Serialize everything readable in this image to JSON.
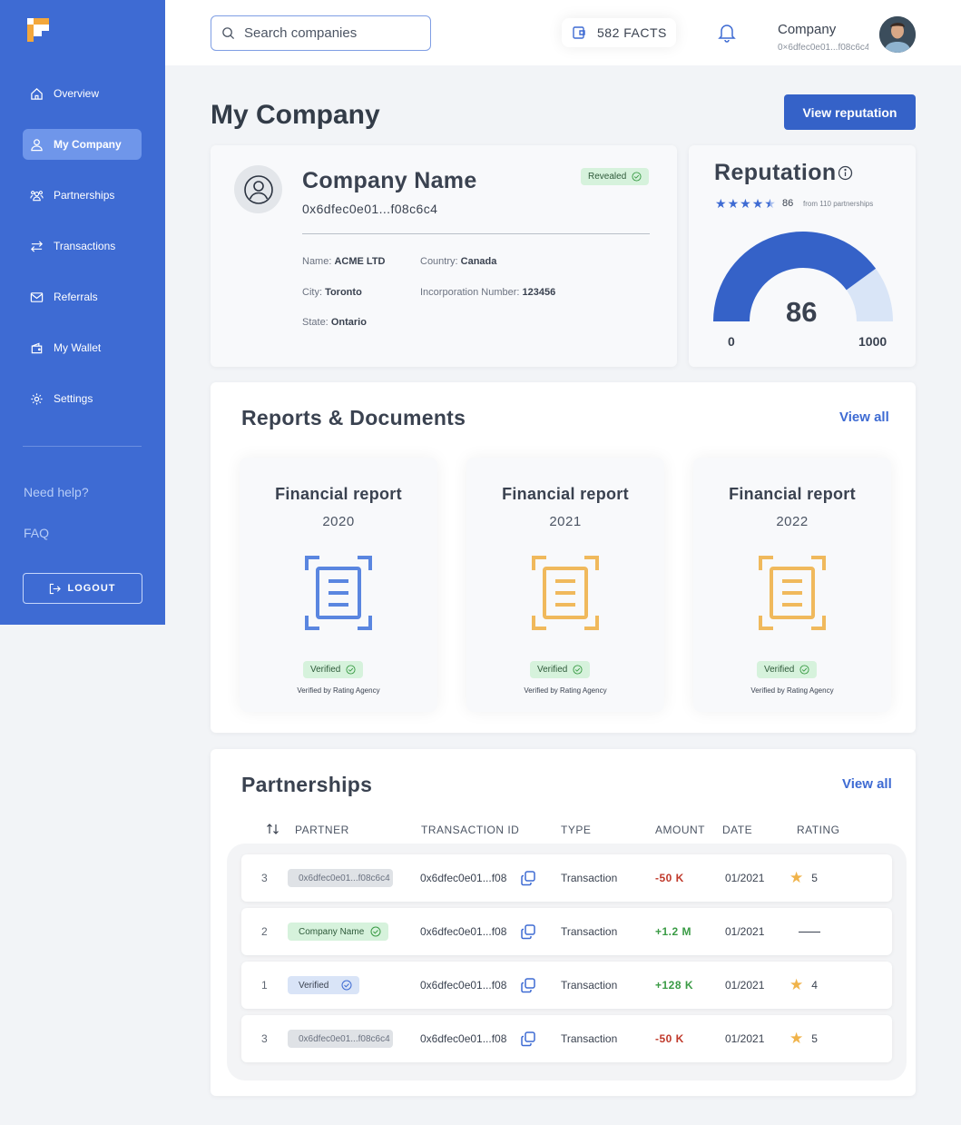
{
  "nav": {
    "items": [
      {
        "label": "Overview",
        "icon": "home-icon"
      },
      {
        "label": "My Company",
        "icon": "user-icon",
        "active": true
      },
      {
        "label": "Partnerships",
        "icon": "partnerships-icon"
      },
      {
        "label": "Transactions",
        "icon": "transfer-icon"
      },
      {
        "label": "Referrals",
        "icon": "mail-icon"
      },
      {
        "label": "My Wallet",
        "icon": "wallet-icon"
      },
      {
        "label": "Settings",
        "icon": "gear-icon"
      }
    ],
    "help": "Need help?",
    "faq": "FAQ",
    "logout": "LOGOUT"
  },
  "topbar": {
    "search_placeholder": "Search companies",
    "facts": "582 FACTS",
    "account_name": "Company",
    "account_address": "0×6dfec0e01...f08c6c4"
  },
  "page": {
    "title": "My Company",
    "cta": "View reputation"
  },
  "company": {
    "name": "Company Name",
    "address": "0x6dfec0e01...f08c6c4",
    "status": "Revealed",
    "fields": {
      "name_label": "Name:",
      "name_value": "ACME LTD",
      "country_label": "Country:",
      "country_value": "Canada",
      "city_label": "City:",
      "city_value": "Toronto",
      "inc_label": "Incorporation Number:",
      "inc_value": "123456",
      "state_label": "State:",
      "state_value": "Ontario"
    }
  },
  "reputation": {
    "title": "Reputation",
    "score": "86",
    "from": "from 110 partnerships",
    "stars": 4.5,
    "gauge_min": "0",
    "gauge_max": "1000",
    "gauge_value": "86",
    "gauge_fill_fraction": 0.8
  },
  "reports": {
    "title": "Reports & Documents",
    "view_all": "View all",
    "items": [
      {
        "title": "Financial report",
        "year": "2020",
        "status": "Verified",
        "verified_by": "Verified by Rating Agency",
        "color": "#5a86e0"
      },
      {
        "title": "Financial report",
        "year": "2021",
        "status": "Verified",
        "verified_by": "Verified by Rating Agency",
        "color": "#f0b95c"
      },
      {
        "title": "Financial report",
        "year": "2022",
        "status": "Verified",
        "verified_by": "Verified by Rating Agency",
        "color": "#f0b95c"
      }
    ]
  },
  "partnerships": {
    "title": "Partnerships",
    "view_all": "View all",
    "columns": [
      "PARTNER",
      "TRANSACTION ID",
      "TYPE",
      "AMOUNT",
      "DATE",
      "RATING"
    ],
    "rows": [
      {
        "idx": "3",
        "partner": "0x6dfec0e01...f08c6c4",
        "partner_style": "grey",
        "txid": "0x6dfec0e01...f08c6c4",
        "type": "Transaction",
        "amount": "-50 K",
        "sign": "neg",
        "date": "01/2021",
        "rating": "5"
      },
      {
        "idx": "2",
        "partner": "Company Name",
        "partner_style": "green",
        "txid": "0x6dfec0e01...f08c6c4",
        "type": "Transaction",
        "amount": "+1.2 M",
        "sign": "pos",
        "date": "01/2021",
        "rating": ""
      },
      {
        "idx": "1",
        "partner": "Verified",
        "partner_style": "blue",
        "txid": "0x6dfec0e01...f08c6c4",
        "type": "Transaction",
        "amount": "+128 K",
        "sign": "pos",
        "date": "01/2021",
        "rating": "4"
      },
      {
        "idx": "3",
        "partner": "0x6dfec0e01...f08c6c4",
        "partner_style": "grey",
        "txid": "0x6dfec0e01...f08c6c4",
        "type": "Transaction",
        "amount": "-50 K",
        "sign": "neg",
        "date": "01/2021",
        "rating": "5"
      }
    ]
  },
  "colors": {
    "sidebar": "#3e6bd3",
    "primary": "#3562c8",
    "positive": "#3a9b45",
    "negative": "#c0392b",
    "star": "#f0b34a"
  }
}
